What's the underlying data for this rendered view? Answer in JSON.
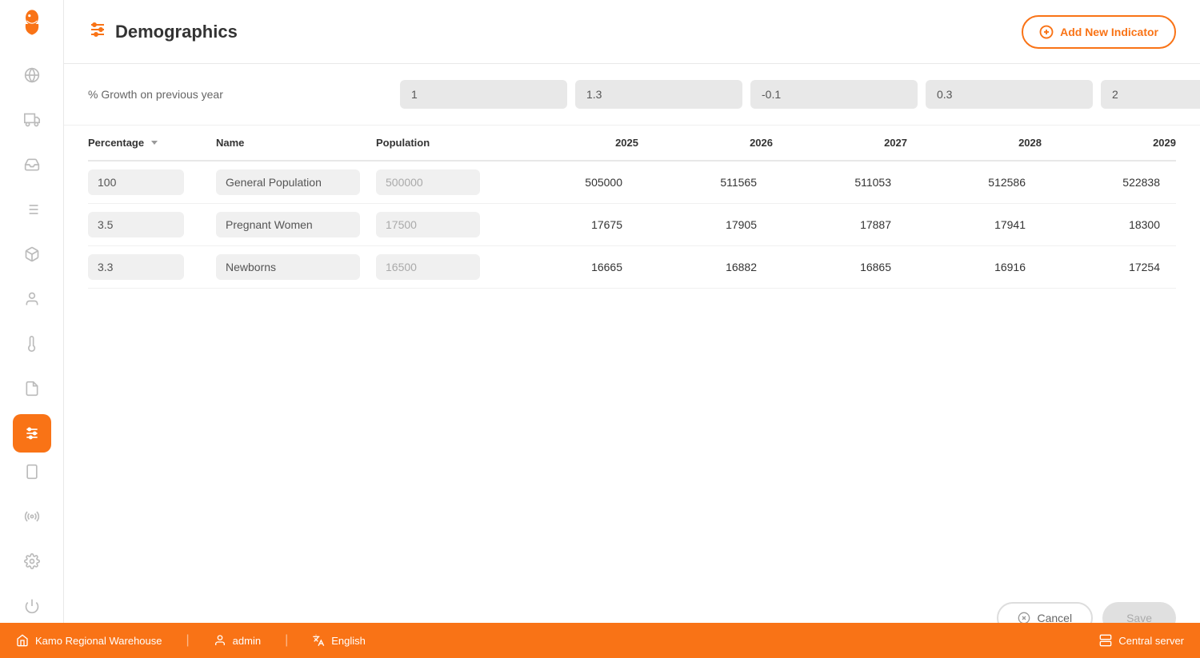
{
  "sidebar": {
    "items": [
      {
        "id": "globe",
        "icon": "🌐",
        "active": false
      },
      {
        "id": "truck",
        "icon": "🚛",
        "active": false
      },
      {
        "id": "inbox",
        "icon": "📥",
        "active": false
      },
      {
        "id": "list",
        "icon": "≡",
        "active": false
      },
      {
        "id": "box",
        "icon": "📦",
        "active": false
      },
      {
        "id": "person",
        "icon": "👤",
        "active": false
      },
      {
        "id": "thermometer",
        "icon": "🌡",
        "active": false
      },
      {
        "id": "document",
        "icon": "📄",
        "active": false
      },
      {
        "id": "sliders",
        "icon": "⊞",
        "active": true
      }
    ],
    "bottom_items": [
      {
        "id": "tablet",
        "icon": "📱"
      },
      {
        "id": "broadcast",
        "icon": "📡"
      },
      {
        "id": "settings",
        "icon": "⚙️"
      },
      {
        "id": "power",
        "icon": "⏻"
      }
    ]
  },
  "header": {
    "title": "Demographics",
    "add_button_label": "Add New Indicator"
  },
  "growth_row": {
    "label": "% Growth on previous year",
    "values": [
      "1",
      "1.3",
      "-0.1",
      "0.3",
      "2"
    ]
  },
  "table": {
    "columns": [
      "Percentage",
      "Name",
      "Population",
      "2025",
      "2026",
      "2027",
      "2028",
      "2029"
    ],
    "rows": [
      {
        "percentage": "100",
        "name": "General Population",
        "population": "500000",
        "values": [
          "505000",
          "511565",
          "511053",
          "512586",
          "522838"
        ]
      },
      {
        "percentage": "3.5",
        "name": "Pregnant Women",
        "population": "17500",
        "values": [
          "17675",
          "17905",
          "17887",
          "17941",
          "18300"
        ]
      },
      {
        "percentage": "3.3",
        "name": "Newborns",
        "population": "16500",
        "values": [
          "16665",
          "16882",
          "16865",
          "16916",
          "17254"
        ]
      }
    ]
  },
  "buttons": {
    "cancel": "Cancel",
    "save": "Save"
  },
  "statusbar": {
    "warehouse": "Kamo Regional Warehouse",
    "user": "admin",
    "language": "English",
    "server": "Central server"
  }
}
